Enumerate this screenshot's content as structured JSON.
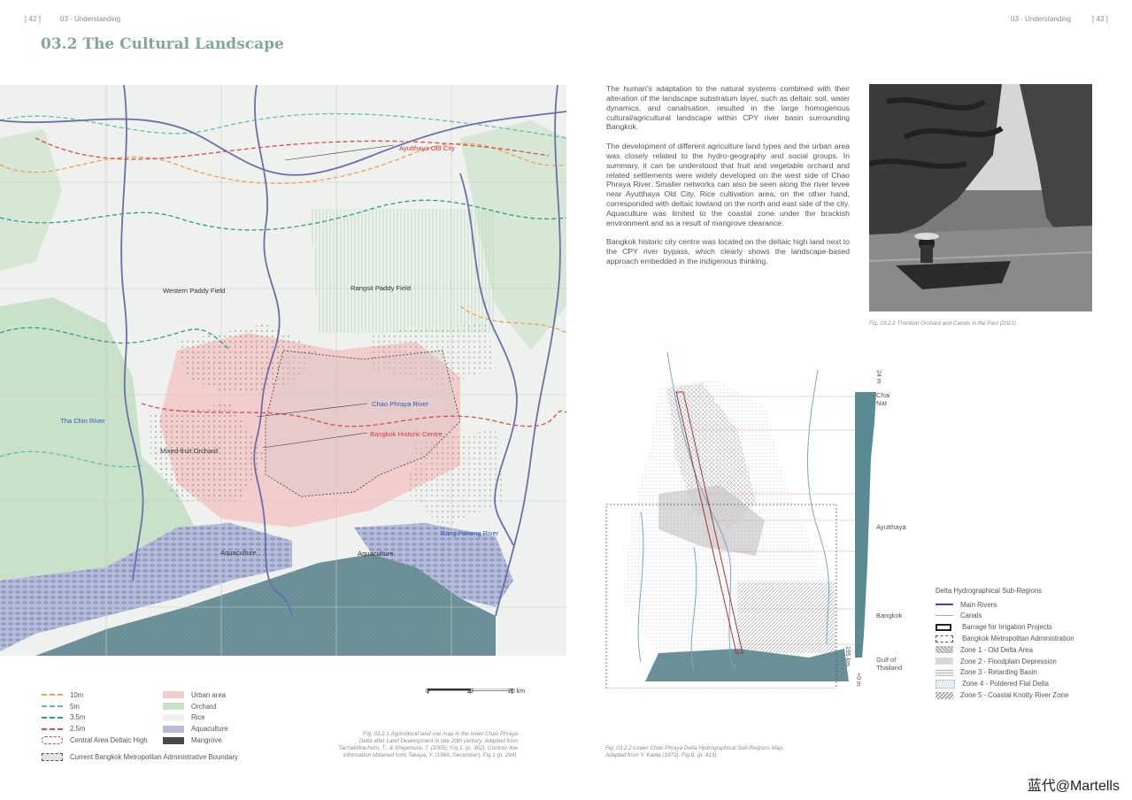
{
  "header": {
    "left_page": "[ 42 ]",
    "left_section": "03 - Understanding",
    "right_section": "03 - Understanding",
    "right_page": "[ 43 ]"
  },
  "title": "03.2 The Cultural Landscape",
  "map": {
    "labels": {
      "ayutthaya": "Ayutthaya Old City",
      "western_paddy": "Western Paddy Field",
      "rangsit_paddy": "Rangsit Paddy Field",
      "chao_phraya": "Chao Phraya River",
      "historic_centre": "Bangkok Historic Centre",
      "tha_chin": "Tha Chin River",
      "mixed_fruit": "Mixed-fruit Orchard",
      "bang_pakong": "Bang Pakong River",
      "aquaculture_west": "Aquaculture",
      "aquaculture_east": "Aquaculture"
    },
    "colors": {
      "rice": "#eef1ee",
      "orchard": "#c9e0c9",
      "urban": "#f3cccc",
      "aquaculture": "#b5bcd8",
      "sea": "#6b8f97",
      "river": "#6a6fa8"
    }
  },
  "legend_left": {
    "contours": [
      {
        "label": "10m",
        "color": "#f0a050"
      },
      {
        "label": "5m",
        "color": "#5cc0b0"
      },
      {
        "label": "3.5m",
        "color": "#2a9c8c"
      },
      {
        "label": "2.5m",
        "color": "#d94c4c"
      }
    ],
    "deltaic_high": "Central Area Deltaic High",
    "boundary": "Current Bangkok Metropolitan Administrative Boundary",
    "landuse": [
      {
        "label": "Urban area",
        "color": "#f3cccc"
      },
      {
        "label": "Orchard",
        "color": "#c9e0c9"
      },
      {
        "label": "Rice",
        "color": "#eef1ee"
      },
      {
        "label": "Aquaculture",
        "color": "#b5bcd8"
      },
      {
        "label": "Mangrove",
        "color": "#4a4a4a"
      }
    ]
  },
  "scale_bar": {
    "tick0": "0",
    "tick1": "10",
    "tick2": "20 km"
  },
  "caption_map": [
    "Fig. 03.2.1 Agricultural land use map in the lower Chao Phraya",
    "Delta after Land Development in late 20th century.  Adapted from",
    "Tachakitkachorn, T., & Shigemura, T. (2005), Fig.1.  (p. 362).  Contour line",
    "information obtained from Takaya, Y. (1969, December), Fig.1 (p. 294)."
  ],
  "body_paragraphs": [
    "The human's adaptation to the natural systems combined with their alteration of the landscape substratum layer, such as deltaic soil, water dynamics, and canalisation, resulted in the large homogenous cultural/agricultural landscape within CPY river basin surrounding Bangkok.",
    "The development of different agriculture land types and the urban area was closely related to the hydro-geography and social groups. In summary, it can be understood that fruit and vegetable orchard and related settlements were widely developed on the west side of Chao Phraya River.  Smaller networks can also be seen along the river levee near Ayutthaya Old City. Rice cultivation area, on the other hand, corresponded with deltaic lowland on the north and east side of the city. Aquaculture was limited to the coastal zone under the brackish environment and as a result of mangrove clearance.",
    "Bangkok historic city centre was located on the deltaic high land next to the CPY river bypass, which clearly shows the landscape-based approach embedded in the indigenous thinking."
  ],
  "photo_caption": "Fig. 03.2.2 Thonburi Orchard and Canals in the Past (2021)",
  "diagram": {
    "elevation_top": "24 m",
    "elevation_bottom": "+0 m",
    "distance": "195 km",
    "places": [
      "Chai Nat",
      "Ayutthaya",
      "Bangkok",
      "Gulf of Thailand"
    ],
    "places_lines": {
      "chai1": "Chai",
      "chai2": "Nat",
      "gulf1": "Gulf of",
      "gulf2": "Thailand"
    }
  },
  "legend_right": {
    "title": "Delta Hydrographical Sub-Regions",
    "items": [
      "Main Rivers",
      "Canals",
      "Barrage for Irrigation Projects",
      "Bangkok Metropolitan Administration",
      "Zone 1 - Old Delta Area",
      "Zone 2 - Floodplain Depression",
      "Zone 3 - Retarding Basin",
      "Zone 4 - Poldered Flat Delta",
      "Zone 5 - Coastal Knotty River Zone"
    ]
  },
  "caption_diagram": [
    "Fig. 03.2.2 Lower Chao Phraya Delta Hydrographical Sub-Regions Map.",
    "Adapted from Y. Kaida (1973). Fig.8. (p. 413)."
  ],
  "watermark": "蓝代@Martells"
}
